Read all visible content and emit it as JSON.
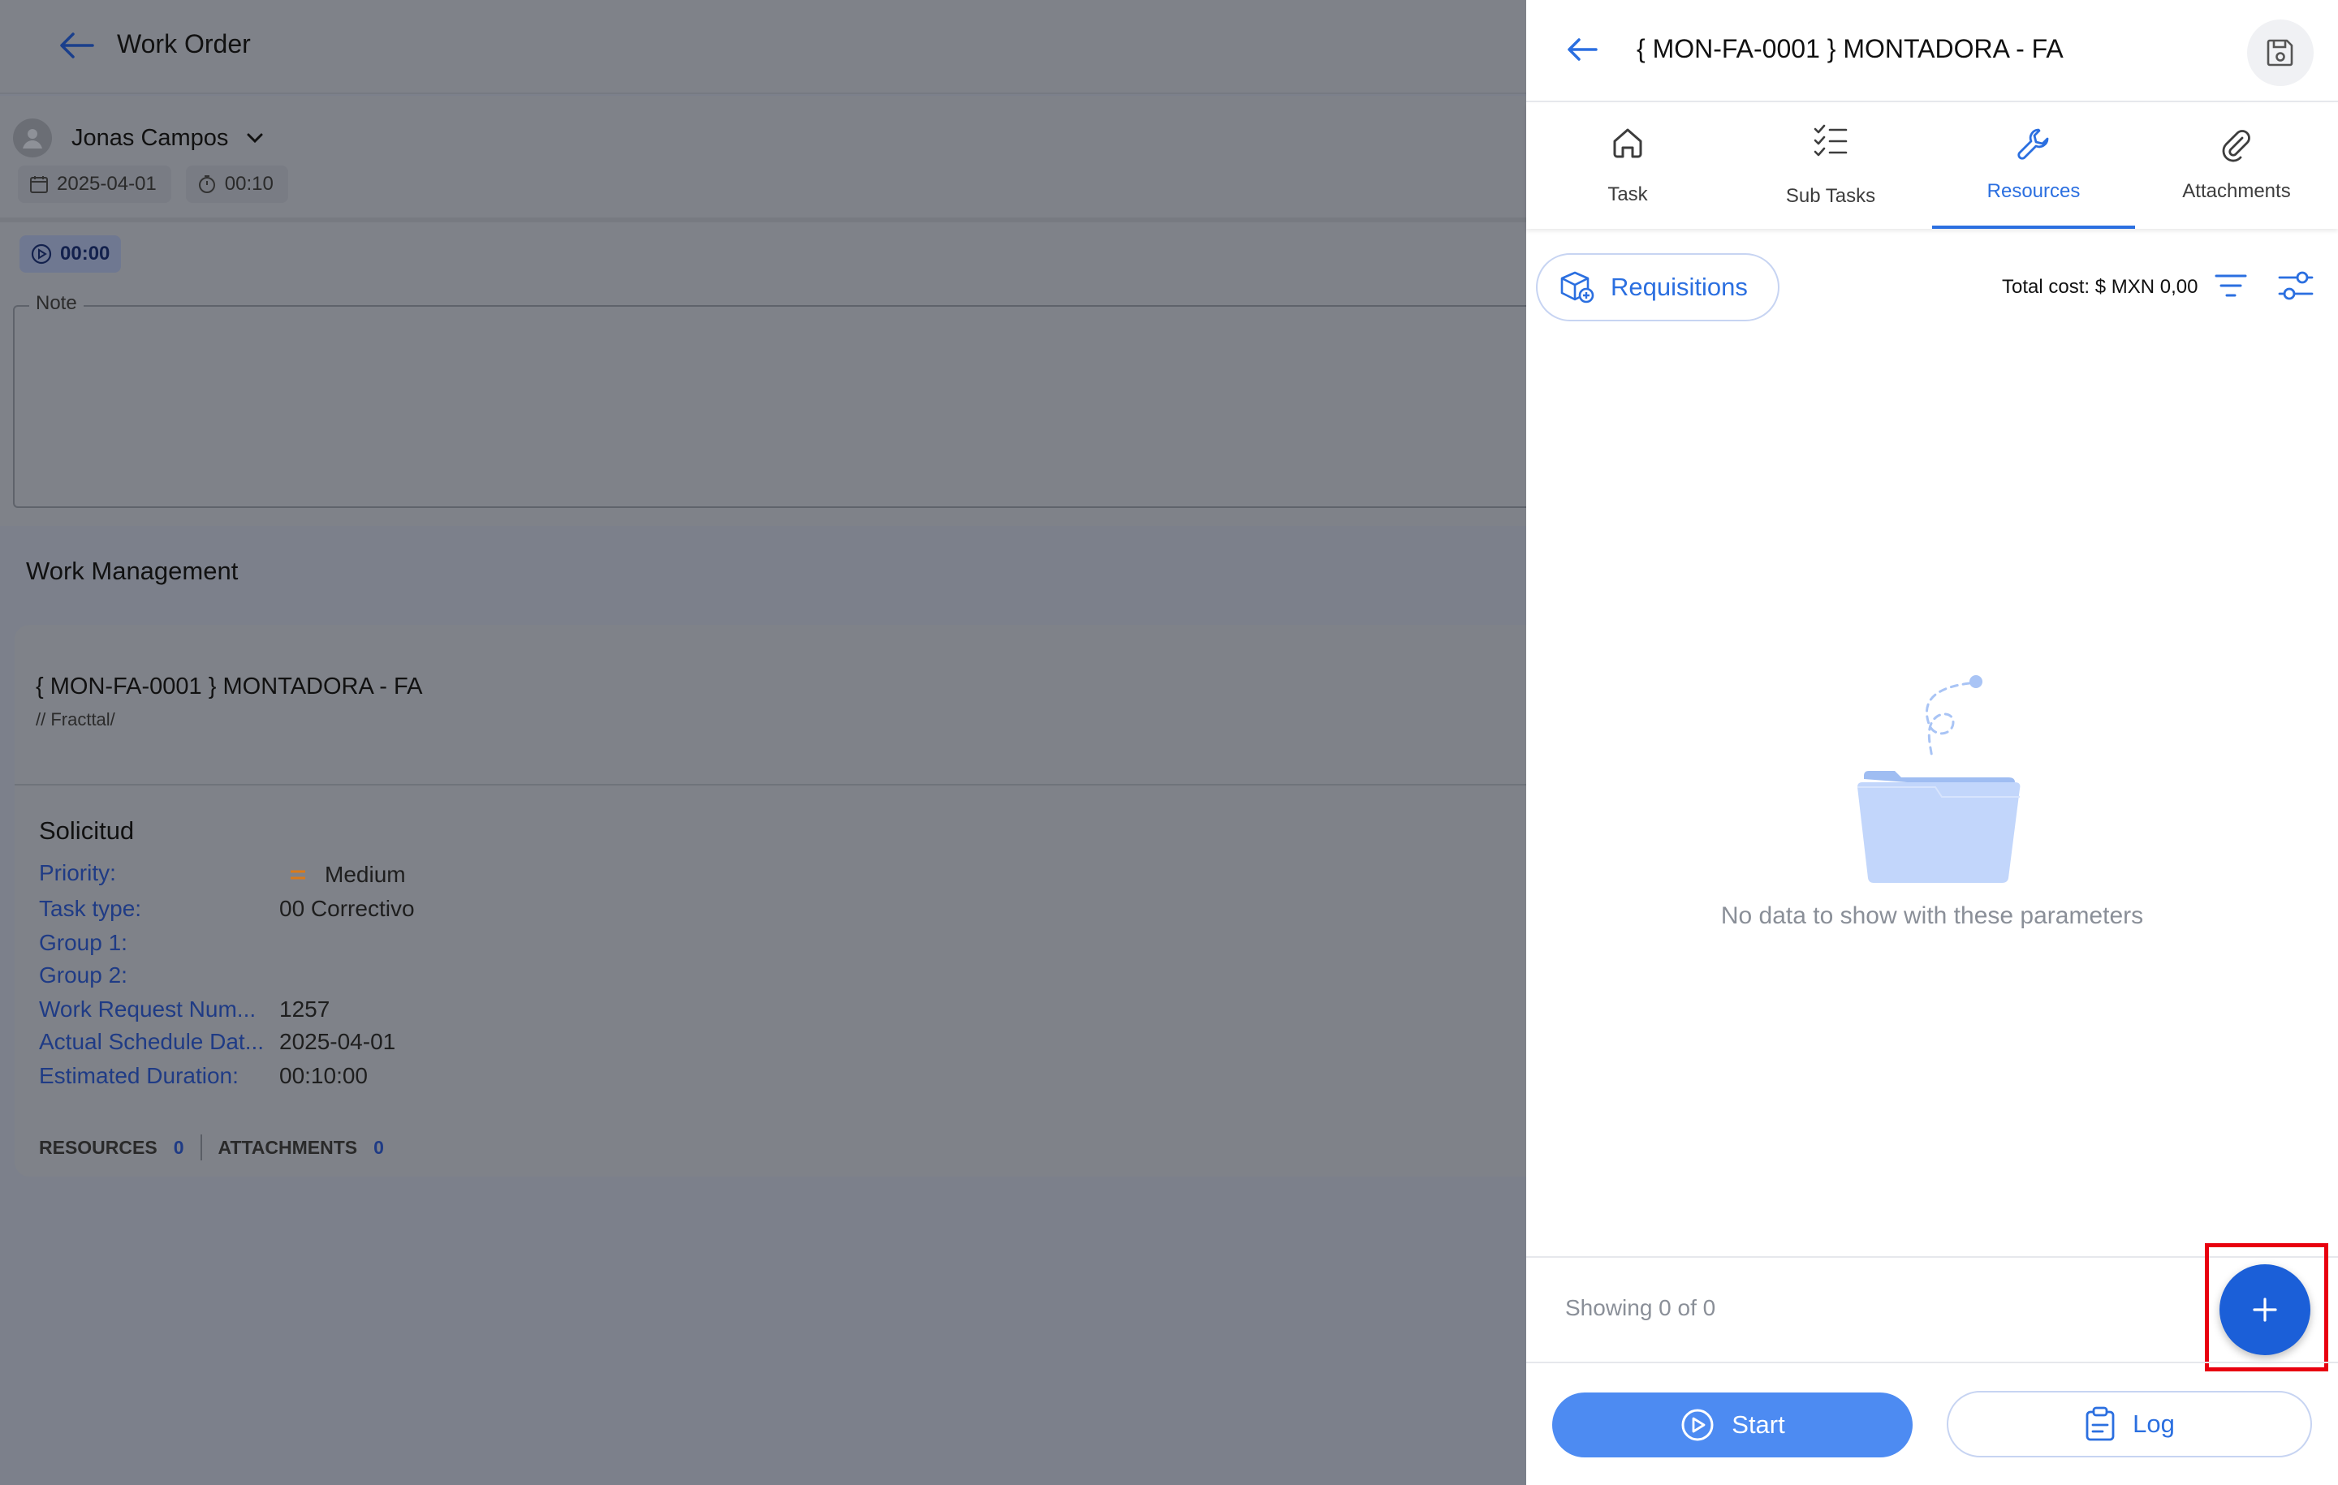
{
  "background_page": {
    "appbar": {
      "title": "Work Order",
      "back_icon": "arrow-left-icon"
    },
    "assignee": {
      "name": "Jonas Campos"
    },
    "chips": {
      "date": "2025-04-01",
      "duration": "00:10"
    },
    "timer": {
      "value": "00:00"
    },
    "note": {
      "label": "Note"
    },
    "section_title": "Work Management",
    "card": {
      "title": "{ MON-FA-0001 } MONTADORA - FA",
      "path": "// Fracttal/",
      "request_title": "Solicitud",
      "fields": [
        {
          "label": "Priority:",
          "value": "Medium"
        },
        {
          "label": "Task type:",
          "value": "00 Correctivo"
        },
        {
          "label": "Group 1:",
          "value": ""
        },
        {
          "label": "Group 2:",
          "value": ""
        },
        {
          "label": "Work Request Num...",
          "value": "1257"
        },
        {
          "label": "Actual Schedule Dat...",
          "value": "2025-04-01"
        },
        {
          "label": "Estimated Duration:",
          "value": "00:10:00"
        }
      ],
      "counts": {
        "resources_label": "RESOURCES",
        "resources_value": "0",
        "attachments_label": "ATTACHMENTS",
        "attachments_value": "0"
      }
    }
  },
  "panel": {
    "header": {
      "title": "{ MON-FA-0001 } MONTADORA - FA"
    },
    "tabs": [
      {
        "label": "Task",
        "icon": "home-icon",
        "active": false
      },
      {
        "label": "Sub Tasks",
        "icon": "checklist-icon",
        "active": false
      },
      {
        "label": "Resources",
        "icon": "wrench-icon",
        "active": true
      },
      {
        "label": "Attachments",
        "icon": "paperclip-icon",
        "active": false
      }
    ],
    "toolbar": {
      "requisitions_label": "Requisitions",
      "total_cost": "Total cost: $ MXN 0,00"
    },
    "empty_state": {
      "text": "No data to show with these parameters"
    },
    "footer": {
      "showing": "Showing 0 of 0"
    },
    "actions": {
      "start_label": "Start",
      "log_label": "Log"
    }
  },
  "colors": {
    "accent": "#2b6fe0",
    "fab": "#1b5fd8",
    "start_button": "#4d8bf2",
    "highlight": "#e8000f",
    "priority_medium": "#d97a1a"
  }
}
